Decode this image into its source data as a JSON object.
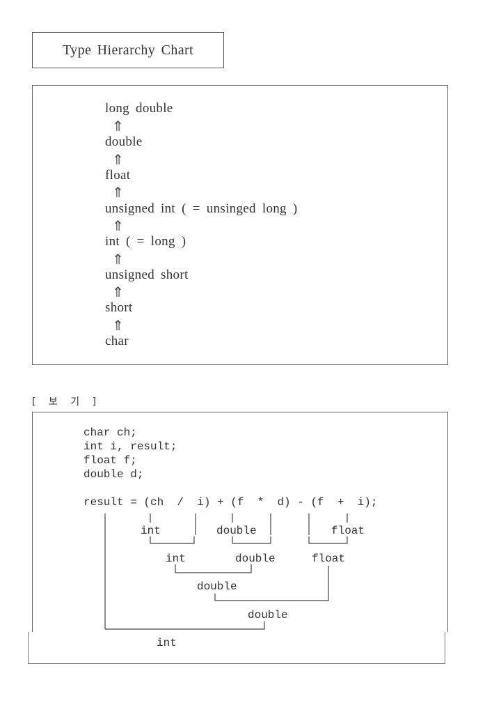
{
  "title": "Type Hierarchy Chart",
  "hierarchy": {
    "arrow": "⇑",
    "types": [
      "long double",
      "double",
      "float",
      "unsigned int ( = unsinged long )",
      "int ( = long )",
      "unsigned short",
      "short",
      "char"
    ]
  },
  "example": {
    "heading": "[ 보 기 ]",
    "code": [
      "char ch;",
      "int i, result;",
      "float f;",
      "double d;",
      "",
      "result = (ch  /  i) + (f  *  d) - (f  +  i);"
    ],
    "labels": {
      "ch_div_i": "int",
      "f_mul_d": "double",
      "f_add_i": "float",
      "level2_left": "int",
      "level2_mid": "double",
      "level2_right": "float",
      "level3": "double",
      "level4": "double",
      "result": "int"
    }
  }
}
